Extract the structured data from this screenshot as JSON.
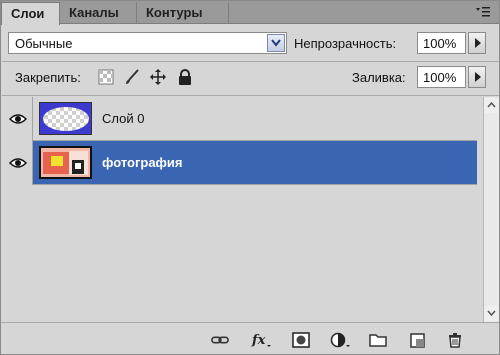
{
  "tabs": [
    {
      "label": "Слои",
      "active": true
    },
    {
      "label": "Каналы",
      "active": false
    },
    {
      "label": "Контуры",
      "active": false
    }
  ],
  "blend_mode": {
    "value": "Обычные"
  },
  "opacity": {
    "label": "Непрозрачность:",
    "value": "100%"
  },
  "lock": {
    "label": "Закрепить:",
    "icons": [
      "lock-transparency-icon",
      "lock-image-icon",
      "lock-position-icon",
      "lock-all-icon"
    ]
  },
  "fill": {
    "label": "Заливка:",
    "value": "100%"
  },
  "layers": [
    {
      "name": "Слой 0",
      "visible": true,
      "selected": false
    },
    {
      "name": "фотография",
      "visible": true,
      "selected": true,
      "smart_object": true
    }
  ],
  "colors": {
    "selection": "#3a65b3",
    "panel": "#d6d6d6",
    "tabbar": "#9a9a9a"
  },
  "bottom_tools": [
    "link-layers-icon",
    "layer-style-fx-icon",
    "add-mask-icon",
    "adjustment-layer-icon",
    "new-group-folder-icon",
    "new-layer-icon",
    "delete-layer-icon"
  ]
}
